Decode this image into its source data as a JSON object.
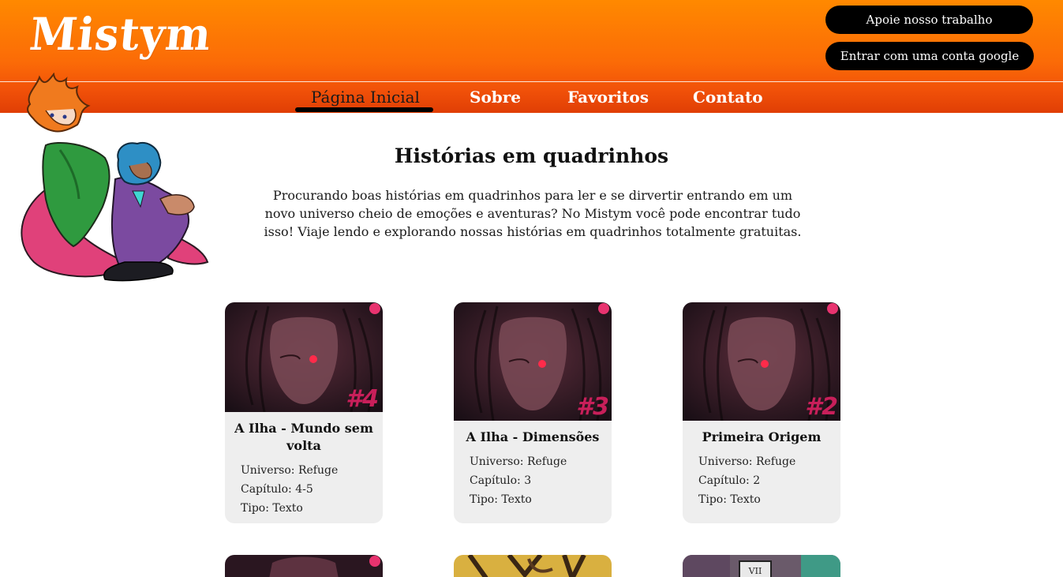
{
  "header": {
    "logo": "Mistym",
    "support_button": "Apoie nosso trabalho",
    "google_button": "Entrar com uma conta google"
  },
  "nav": {
    "items": [
      "Página Inicial",
      "Sobre",
      "Favoritos",
      "Contato"
    ],
    "active": "Página Inicial"
  },
  "intro": {
    "title": "Histórias em quadrinhos",
    "text": "Procurando boas histórias em quadrinhos para ler e se dirvertir entrando em um novo universo cheio de emoções e aventuras? No Mistym você pode encontrar tudo isso! Viaje lendo e explorando nossas histórias em quadrinhos totalmente gratuitas."
  },
  "cards": [
    {
      "number": "#4",
      "title": "A Ilha - Mundo sem volta",
      "universe": "Universo: Refuge",
      "chapter": "Capítulo: 4-5",
      "type": "Tipo: Texto"
    },
    {
      "number": "#3",
      "title": "A Ilha - Dimensões",
      "universe": "Universo: Refuge",
      "chapter": "Capítulo: 3",
      "type": "Tipo: Texto"
    },
    {
      "number": "#2",
      "title": "Primeira Origem",
      "universe": "Universo: Refuge",
      "chapter": "Capítulo: 2",
      "type": "Tipo: Texto"
    }
  ],
  "next_row_badge": "VII",
  "colors": {
    "header_top": "#ff8900",
    "header_bottom": "#e03e05",
    "card_bg": "#eeeeee",
    "cover_dark": "#2a1620",
    "accent_pink": "#e8336f"
  }
}
